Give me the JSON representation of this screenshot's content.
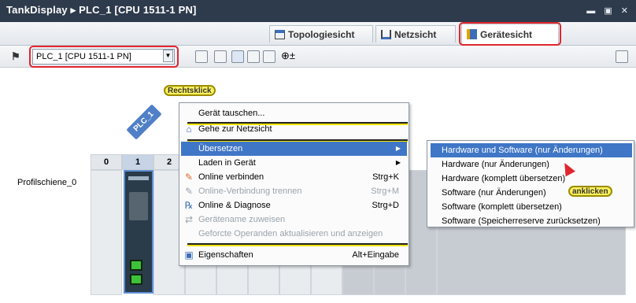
{
  "window": {
    "title": "TankDisplay ▸ PLC_1 [CPU 1511-1 PN]",
    "controls": "▬ ▣ ✕"
  },
  "tabs": [
    {
      "label": "Topologiesicht",
      "icon": "topology-icon"
    },
    {
      "label": "Netzsicht",
      "icon": "network-icon"
    },
    {
      "label": "Gerätesicht",
      "icon": "device-icon"
    }
  ],
  "toolbar": {
    "device_select_value": "PLC_1 [CPU 1511-1 PN]"
  },
  "canvas": {
    "plc_tag": "PLC_1",
    "callout_rightclick": "Rechtsklick",
    "callout_click": "anklicken",
    "rail_label": "Profilschiene_0",
    "slot_headers": [
      "0",
      "1",
      "2"
    ]
  },
  "context_menu": {
    "items": [
      {
        "label": "Gerät tauschen...",
        "shortcut": "",
        "disabled": false
      },
      {
        "label": "Gehe zur Netzsicht",
        "shortcut": "",
        "disabled": false
      },
      {
        "label": "Übersetzen",
        "shortcut": "",
        "disabled": false
      },
      {
        "label": "Laden in Gerät",
        "shortcut": "",
        "disabled": false
      },
      {
        "label": "Online verbinden",
        "shortcut": "Strg+K",
        "disabled": false
      },
      {
        "label": "Online-Verbindung trennen",
        "shortcut": "Strg+M",
        "disabled": true
      },
      {
        "label": "Online & Diagnose",
        "shortcut": "Strg+D",
        "disabled": false
      },
      {
        "label": "Gerätename zuweisen",
        "shortcut": "",
        "disabled": true
      },
      {
        "label": "Geforcte Operanden aktualisieren und anzeigen",
        "shortcut": "",
        "disabled": true
      },
      {
        "label": "Eigenschaften",
        "shortcut": "Alt+Eingabe",
        "disabled": false
      }
    ]
  },
  "submenu": {
    "items": [
      "Hardware und Software (nur Änderungen)",
      "Hardware (nur Änderungen)",
      "Hardware (komplett übersetzen)",
      "Software (nur Änderungen)",
      "Software (komplett übersetzen)",
      "Software (Speicherreserve zurücksetzen)"
    ]
  }
}
